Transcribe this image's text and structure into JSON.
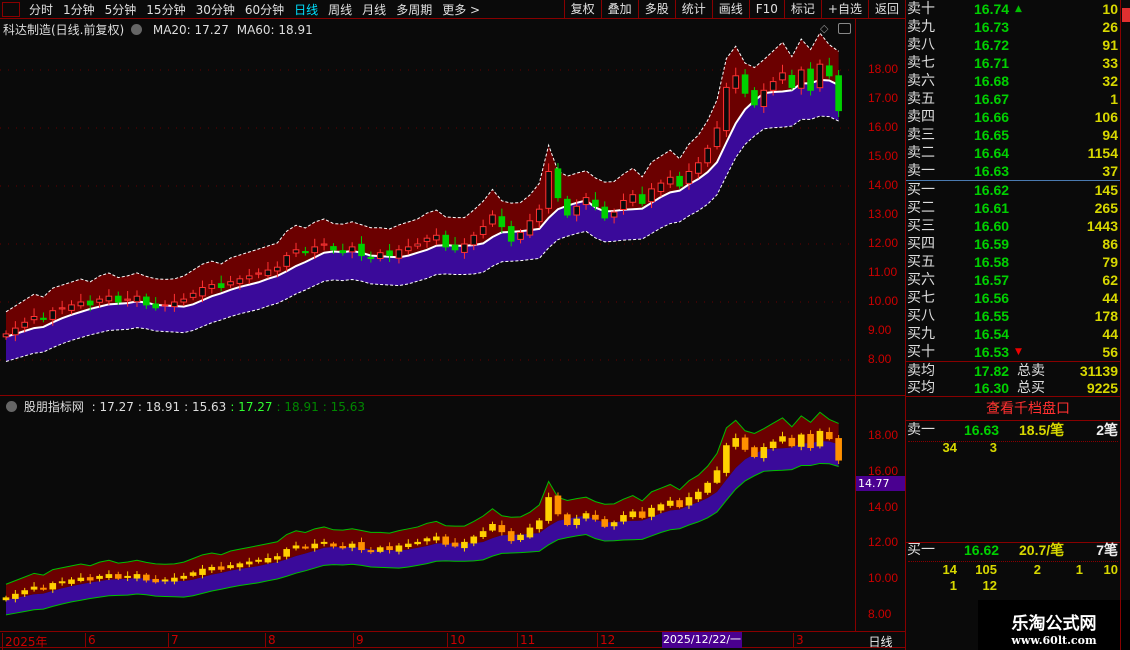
{
  "toolbar": {
    "periods": [
      "分时",
      "1分钟",
      "5分钟",
      "15分钟",
      "30分钟",
      "60分钟",
      "日线",
      "周线",
      "月线",
      "多周期",
      "更多 >"
    ],
    "active": "日线",
    "buttons": [
      "复权",
      "叠加",
      "多股",
      "统计",
      "画线",
      "F10",
      "标记",
      "+自选",
      "返回"
    ]
  },
  "main_chart": {
    "title": "科达制造(日线.前复权)",
    "ma20": "MA20: 17.27",
    "ma60": "MA60: 18.91",
    "y_ticks": [
      "18.00",
      "17.00",
      "16.00",
      "15.00",
      "14.00",
      "13.00",
      "12.00",
      "11.00",
      "10.00",
      "9.00",
      "8.00"
    ]
  },
  "indicator": {
    "name": "股朋指标网",
    "values_white": [
      ": 17.27",
      ": 18.91",
      ": 15.63"
    ],
    "values_green": [
      ": 17.27",
      ": 18.91",
      ": 15.63"
    ],
    "y_ticks": [
      "18.00",
      "16.00",
      "14.00",
      "12.00",
      "10.00",
      "8.00"
    ],
    "price_tag": "14.77"
  },
  "x_axis": {
    "labels": [
      "2025年",
      "6",
      "7",
      "8",
      "9",
      "10",
      "11",
      "12",
      "3"
    ],
    "selected": "2025/12/22/一",
    "period": "日线"
  },
  "chart_data": {
    "type": "candlestick",
    "close": [
      8.9,
      9.1,
      9.3,
      9.5,
      9.4,
      9.7,
      9.8,
      9.9,
      10.0,
      9.9,
      10.1,
      10.2,
      10.0,
      10.1,
      10.2,
      9.9,
      9.8,
      9.9,
      10.0,
      10.1,
      10.3,
      10.5,
      10.6,
      10.5,
      10.7,
      10.8,
      10.9,
      11.0,
      11.1,
      11.2,
      11.6,
      11.8,
      11.7,
      11.9,
      12.0,
      11.8,
      11.7,
      11.9,
      11.6,
      11.5,
      11.7,
      11.6,
      11.8,
      11.9,
      12.0,
      12.2,
      12.3,
      11.9,
      11.8,
      12.0,
      12.3,
      12.6,
      13.0,
      12.6,
      12.1,
      12.4,
      12.8,
      13.2,
      14.5,
      13.6,
      13.0,
      13.3,
      13.6,
      13.3,
      12.9,
      13.1,
      13.5,
      13.7,
      13.4,
      13.9,
      14.1,
      14.3,
      14.0,
      14.5,
      14.8,
      15.3,
      16.0,
      17.4,
      17.8,
      17.2,
      16.8,
      17.3,
      17.6,
      17.9,
      17.4,
      18.0,
      17.3,
      18.2,
      17.8,
      16.6
    ],
    "ylim": [
      7.5,
      19.5
    ],
    "colors": {
      "up": "#ff3232",
      "down": "#00d000",
      "upper_band": "#6b0000",
      "lower_band": "#3a0a9a"
    }
  },
  "order_book": {
    "asks": [
      {
        "label": "卖十",
        "price": "16.74",
        "vol": "10"
      },
      {
        "label": "卖九",
        "price": "16.73",
        "vol": "26"
      },
      {
        "label": "卖八",
        "price": "16.72",
        "vol": "91"
      },
      {
        "label": "卖七",
        "price": "16.71",
        "vol": "33"
      },
      {
        "label": "卖六",
        "price": "16.68",
        "vol": "32"
      },
      {
        "label": "卖五",
        "price": "16.67",
        "vol": "1"
      },
      {
        "label": "卖四",
        "price": "16.66",
        "vol": "106"
      },
      {
        "label": "卖三",
        "price": "16.65",
        "vol": "94"
      },
      {
        "label": "卖二",
        "price": "16.64",
        "vol": "1154"
      },
      {
        "label": "卖一",
        "price": "16.63",
        "vol": "37"
      }
    ],
    "bids": [
      {
        "label": "买一",
        "price": "16.62",
        "vol": "145"
      },
      {
        "label": "买二",
        "price": "16.61",
        "vol": "265"
      },
      {
        "label": "买三",
        "price": "16.60",
        "vol": "1443"
      },
      {
        "label": "买四",
        "price": "16.59",
        "vol": "86"
      },
      {
        "label": "买五",
        "price": "16.58",
        "vol": "79"
      },
      {
        "label": "买六",
        "price": "16.57",
        "vol": "62"
      },
      {
        "label": "买七",
        "price": "16.56",
        "vol": "44"
      },
      {
        "label": "买八",
        "price": "16.55",
        "vol": "178"
      },
      {
        "label": "买九",
        "price": "16.54",
        "vol": "44"
      },
      {
        "label": "买十",
        "price": "16.53",
        "vol": "56"
      }
    ],
    "avg_sell": {
      "label": "卖均",
      "price": "17.82",
      "total_label": "总卖",
      "total": "31139"
    },
    "avg_buy": {
      "label": "买均",
      "price": "16.30",
      "total_label": "总买",
      "total": "9225"
    }
  },
  "depth": {
    "link": "查看千档盘口",
    "sell1": {
      "label": "卖一",
      "price": "16.63",
      "per": "18.5/笔",
      "count": "2笔",
      "orders": [
        "34",
        "3"
      ]
    },
    "buy1": {
      "label": "买一",
      "price": "16.62",
      "per": "20.7/笔",
      "count": "7笔",
      "orders": [
        "14",
        "105",
        "2",
        "1",
        "10",
        "1",
        "12"
      ]
    }
  },
  "watermark": {
    "name": "乐淘公式网",
    "url": "www.60lt.com"
  }
}
